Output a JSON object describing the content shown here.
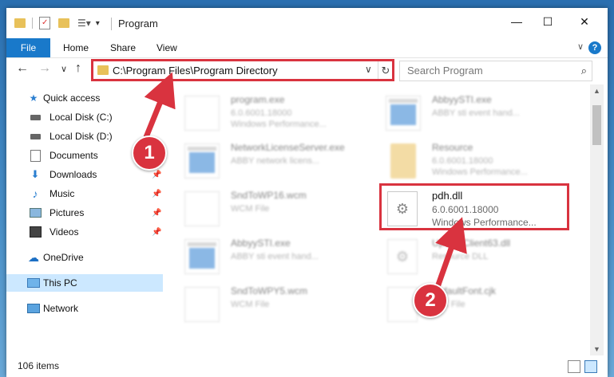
{
  "window": {
    "title": "Program",
    "controls": {
      "minimize": "—",
      "maximize": "☐",
      "close": "✕"
    }
  },
  "ribbon": {
    "tabs": [
      "File",
      "Home",
      "Share",
      "View"
    ],
    "help": "?",
    "collapse": "∨"
  },
  "address": {
    "path": "C:\\Program Files\\Program Directory",
    "search_placeholder": "Search Program"
  },
  "nav": {
    "back": "←",
    "forward": "→",
    "recent": "∨",
    "up": "↑"
  },
  "sidebar": {
    "items": [
      {
        "label": "Quick access",
        "icon": "star-icon",
        "pinned": false
      },
      {
        "label": "Local Disk (C:)",
        "icon": "drive-icon",
        "pinned": false
      },
      {
        "label": "Local Disk (D:)",
        "icon": "drive-icon",
        "pinned": false
      },
      {
        "label": "Documents",
        "icon": "documents-icon",
        "pinned": true
      },
      {
        "label": "Downloads",
        "icon": "download-icon",
        "pinned": true
      },
      {
        "label": "Music",
        "icon": "music-icon",
        "pinned": true
      },
      {
        "label": "Pictures",
        "icon": "pictures-icon",
        "pinned": true
      },
      {
        "label": "Videos",
        "icon": "videos-icon",
        "pinned": true
      },
      {
        "label": "OneDrive",
        "icon": "cloud-icon",
        "pinned": false
      },
      {
        "label": "This PC",
        "icon": "computer-icon",
        "pinned": false
      },
      {
        "label": "Network",
        "icon": "network-icon",
        "pinned": false
      }
    ]
  },
  "files": [
    {
      "name": "program.exe",
      "line1": "6.0.6001.18000",
      "line2": "Windows Performance...",
      "kind": "doc"
    },
    {
      "name": "AbbyySTI.exe",
      "line1": "ABBY sti event hand...",
      "line2": "",
      "kind": "app"
    },
    {
      "name": "NetworkLicenseServer.exe",
      "line1": "ABBY network licens...",
      "line2": "",
      "kind": "app"
    },
    {
      "name": "Resource",
      "line1": "6.0.6001.18000",
      "line2": "Windows Performance...",
      "kind": "folder"
    },
    {
      "name": "SndToWP16.wcm",
      "line1": "WCM File",
      "line2": "",
      "kind": "doc"
    },
    {
      "name": "pdh.dll",
      "line1": "6.0.6001.18000",
      "line2": "Windows Performance...",
      "kind": "gear"
    },
    {
      "name": "AbbyySTI.exe",
      "line1": "ABBY sti event hand...",
      "line2": "",
      "kind": "app"
    },
    {
      "name": "UpdateClient63.dll",
      "line1": "Resource DLL",
      "line2": "",
      "kind": "gear"
    },
    {
      "name": "SndToWPY5.wcm",
      "line1": "WCM File",
      "line2": "",
      "kind": "doc"
    },
    {
      "name": "DefaultFont.cjk",
      "line1": "CJK File",
      "line2": "",
      "kind": "doc"
    }
  ],
  "status": {
    "count": "106 items"
  },
  "annotations": {
    "step1": "1",
    "step2": "2",
    "color": "#d9333f"
  }
}
